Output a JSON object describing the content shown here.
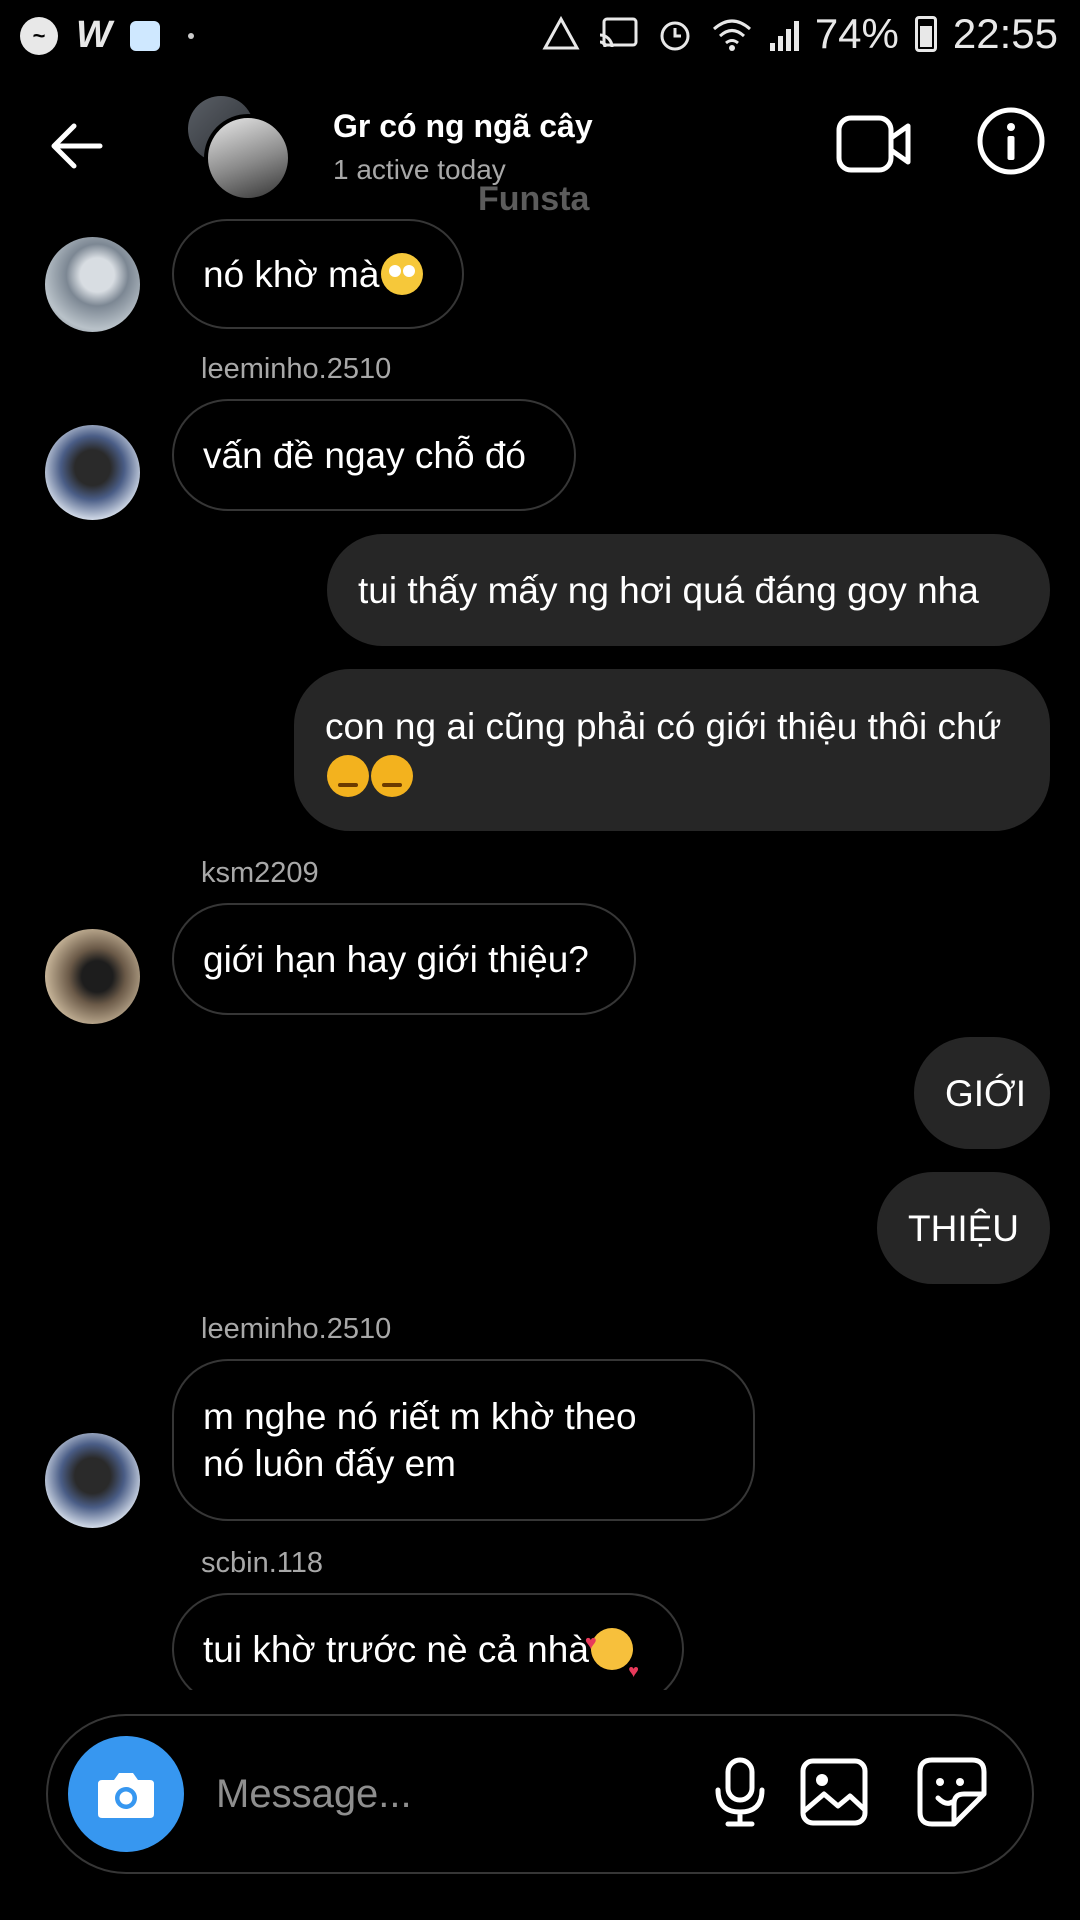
{
  "status_bar": {
    "battery": "74%",
    "time": "22:55"
  },
  "header": {
    "title": "Gr có ng ngã cây",
    "subtitle": "1 active today",
    "watermark": "Funsta"
  },
  "messages": [
    {
      "type": "in",
      "text": "nó khờ mà"
    },
    {
      "type": "sender",
      "text": "leeminho.2510"
    },
    {
      "type": "in",
      "text": "vấn đề ngay chỗ đó"
    },
    {
      "type": "out",
      "text": "tui thấy mấy ng hơi quá đáng goy nha"
    },
    {
      "type": "out",
      "text": "con ng ai cũng phải có giới thiệu thôi chứ"
    },
    {
      "type": "sender",
      "text": "ksm2209"
    },
    {
      "type": "in",
      "text": "giới hạn hay giới thiệu?"
    },
    {
      "type": "out",
      "text": "GIỚI"
    },
    {
      "type": "out",
      "text": "THIỆU"
    },
    {
      "type": "sender",
      "text": "leeminho.2510"
    },
    {
      "type": "in",
      "text": "m nghe nó riết m khờ theo nó luôn đấy em"
    },
    {
      "type": "sender",
      "text": "scbin.118"
    },
    {
      "type": "in",
      "text": "tui khờ trước nè cả nhà"
    }
  ],
  "composer": {
    "placeholder": "Message..."
  },
  "icons": {
    "back": "arrow-left-icon",
    "video": "video-call-icon",
    "info": "info-icon",
    "camera": "camera-icon",
    "mic": "microphone-icon",
    "gallery": "gallery-icon",
    "sticker": "sticker-icon"
  },
  "colors": {
    "accent": "#3797f0",
    "bubble_out": "#262626",
    "bubble_in_border": "#363636",
    "background": "#000000"
  }
}
